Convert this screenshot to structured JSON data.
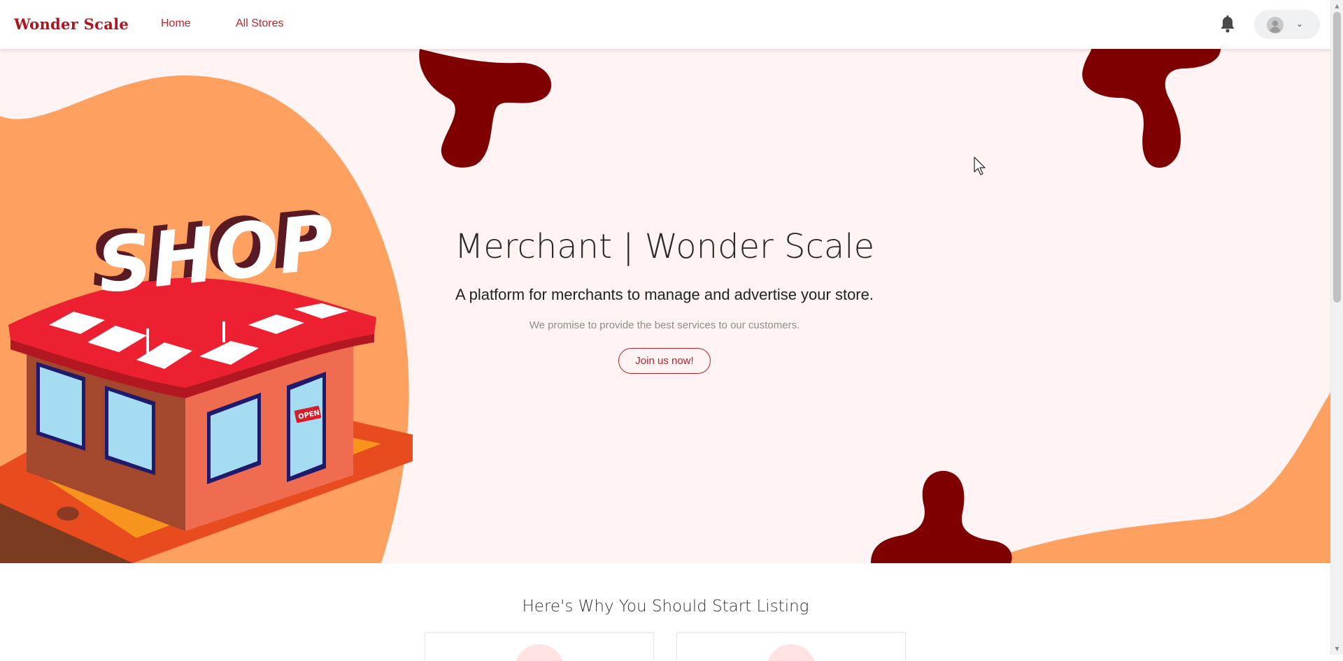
{
  "brand": {
    "name": "Wonder Scale"
  },
  "nav": {
    "home": "Home",
    "stores": "All Stores"
  },
  "hero": {
    "title": "Merchant | Wonder Scale",
    "subtitle": "A platform for merchants to manage and advertise your store.",
    "tagline": "We promise to provide the best services to our customers.",
    "cta": "Join us now!",
    "illustration": {
      "sign": "SHOP",
      "door_sign": "OPEN"
    }
  },
  "features": {
    "title": "Here's Why You Should Start Listing"
  },
  "icons": {
    "notifications": "bell-icon",
    "user": "user-avatar-icon",
    "menu_toggle": "chevron-down-icon"
  },
  "colors": {
    "brand": "#b3111b",
    "accent_orange": "#fea05f",
    "dark_red": "#7e0000",
    "hero_bg": "#fff4f3"
  }
}
